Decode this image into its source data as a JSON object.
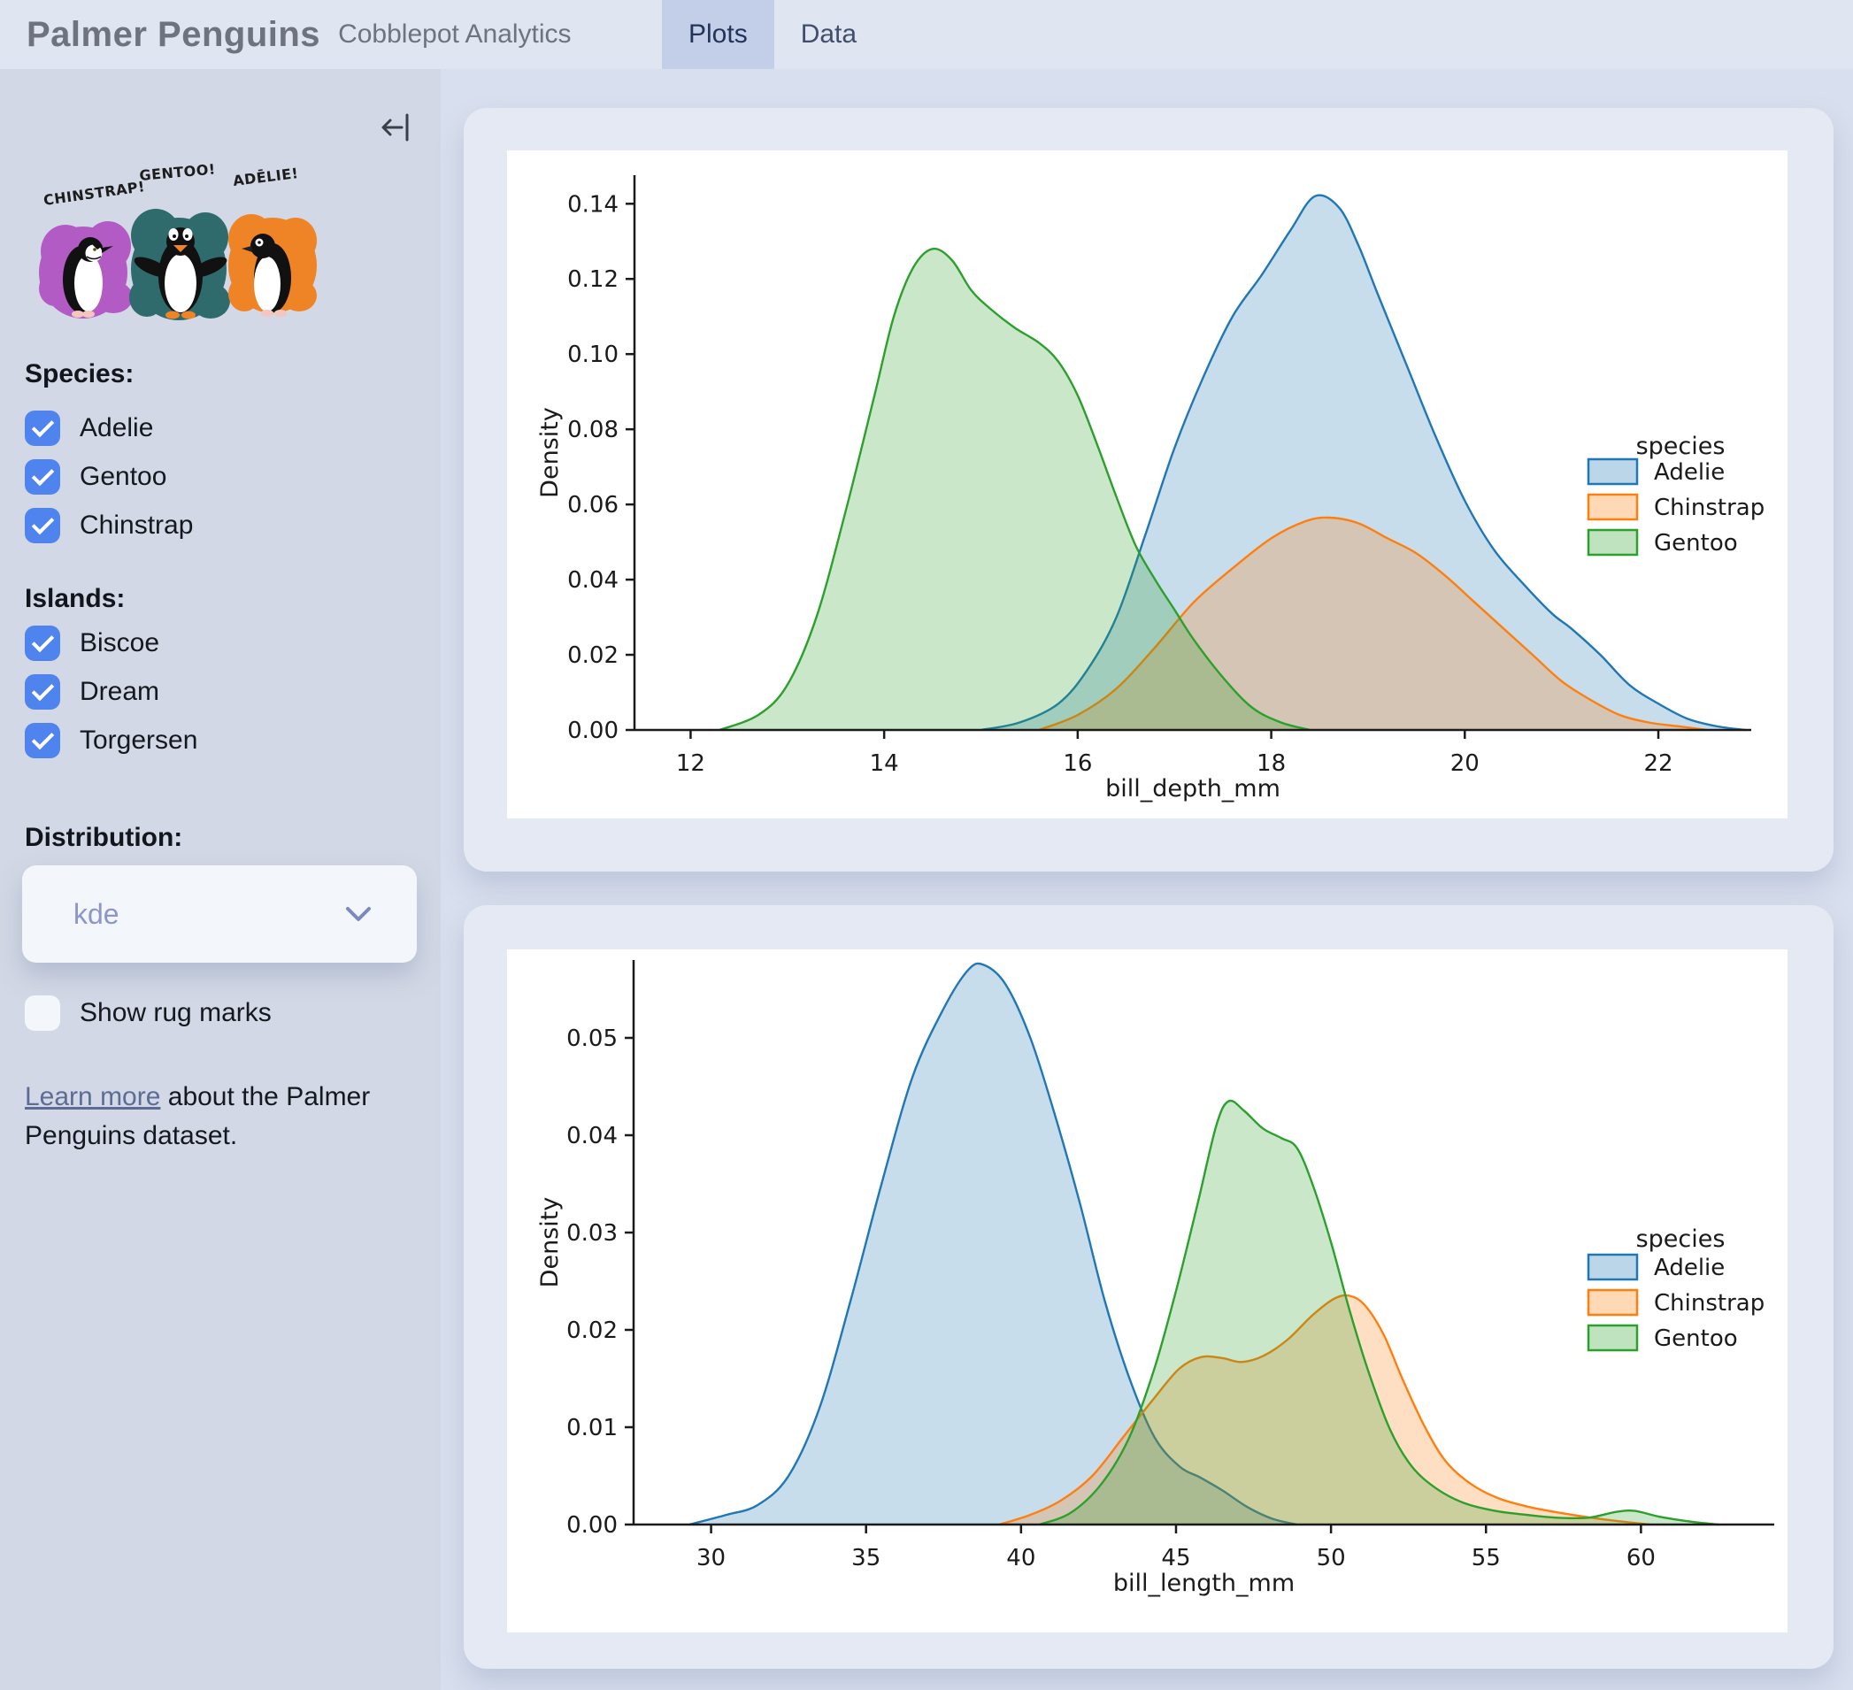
{
  "header": {
    "title": "Palmer Penguins",
    "subtitle": "Cobblepot Analytics",
    "tabs": [
      {
        "label": "Plots",
        "active": true
      },
      {
        "label": "Data",
        "active": false
      }
    ]
  },
  "sidebar": {
    "artwork_labels": {
      "chinstrap": "CHINSTRAP!",
      "gentoo": "GENTOO!",
      "adelie": "ADĒLIE!"
    },
    "species": {
      "heading": "Species:",
      "options": [
        {
          "label": "Adelie",
          "checked": true
        },
        {
          "label": "Gentoo",
          "checked": true
        },
        {
          "label": "Chinstrap",
          "checked": true
        }
      ]
    },
    "islands": {
      "heading": "Islands:",
      "options": [
        {
          "label": "Biscoe",
          "checked": true
        },
        {
          "label": "Dream",
          "checked": true
        },
        {
          "label": "Torgersen",
          "checked": true
        }
      ]
    },
    "distribution": {
      "heading": "Distribution:",
      "selected": "kde"
    },
    "rug": {
      "label": "Show rug marks",
      "checked": false
    },
    "footnote": {
      "link_text": "Learn more",
      "text_after": " about the Palmer Penguins dataset."
    }
  },
  "colors": {
    "adelie": "#1f77b4",
    "chinstrap": "#ff7f0e",
    "gentoo": "#2ca02c",
    "checkbox_blue": "#4f83ee",
    "tab_active_bg": "#c3cee8",
    "art_purple": "#b35bc4",
    "art_teal": "#2f6a6d",
    "art_orange": "#ef8426"
  },
  "chart_data": [
    {
      "type": "area",
      "kind": "kde",
      "xlabel": "bill_depth_mm",
      "ylabel": "Density",
      "xlim": [
        11.42,
        22.96
      ],
      "ylim": [
        0,
        0.1476
      ],
      "xticks": [
        12,
        14,
        16,
        18,
        20,
        22
      ],
      "yticks": [
        0.0,
        0.02,
        0.04,
        0.06,
        0.08,
        0.1,
        0.12,
        0.14
      ],
      "legend_title": "species",
      "legend_position": "center right",
      "grid": false,
      "series": [
        {
          "name": "Adelie",
          "color": "#1f77b4",
          "points": [
            [
              15.0,
              0
            ],
            [
              15.4,
              0.002
            ],
            [
              15.8,
              0.007
            ],
            [
              16.1,
              0.016
            ],
            [
              16.4,
              0.03
            ],
            [
              16.7,
              0.052
            ],
            [
              17.0,
              0.075
            ],
            [
              17.3,
              0.094
            ],
            [
              17.6,
              0.11
            ],
            [
              17.9,
              0.121
            ],
            [
              18.2,
              0.133
            ],
            [
              18.45,
              0.142
            ],
            [
              18.7,
              0.139
            ],
            [
              18.9,
              0.129
            ],
            [
              19.1,
              0.116
            ],
            [
              19.4,
              0.097
            ],
            [
              19.7,
              0.078
            ],
            [
              20.0,
              0.061
            ],
            [
              20.3,
              0.048
            ],
            [
              20.6,
              0.039
            ],
            [
              20.9,
              0.031
            ],
            [
              21.1,
              0.027
            ],
            [
              21.4,
              0.02
            ],
            [
              21.7,
              0.012
            ],
            [
              22.0,
              0.007
            ],
            [
              22.3,
              0.003
            ],
            [
              22.6,
              0.001
            ],
            [
              22.9,
              0
            ]
          ]
        },
        {
          "name": "Chinstrap",
          "color": "#ff7f0e",
          "points": [
            [
              15.6,
              0
            ],
            [
              16.0,
              0.004
            ],
            [
              16.4,
              0.011
            ],
            [
              16.8,
              0.022
            ],
            [
              17.2,
              0.034
            ],
            [
              17.6,
              0.043
            ],
            [
              18.0,
              0.051
            ],
            [
              18.35,
              0.0555
            ],
            [
              18.6,
              0.0565
            ],
            [
              18.9,
              0.055
            ],
            [
              19.2,
              0.051
            ],
            [
              19.5,
              0.047
            ],
            [
              19.8,
              0.041
            ],
            [
              20.1,
              0.034
            ],
            [
              20.4,
              0.027
            ],
            [
              20.7,
              0.02
            ],
            [
              21.0,
              0.013
            ],
            [
              21.3,
              0.008
            ],
            [
              21.6,
              0.004
            ],
            [
              21.9,
              0.002
            ],
            [
              22.2,
              0.001
            ],
            [
              22.5,
              0
            ]
          ]
        },
        {
          "name": "Gentoo",
          "color": "#2ca02c",
          "points": [
            [
              12.3,
              0
            ],
            [
              12.7,
              0.004
            ],
            [
              13.0,
              0.012
            ],
            [
              13.3,
              0.03
            ],
            [
              13.6,
              0.058
            ],
            [
              13.9,
              0.089
            ],
            [
              14.1,
              0.11
            ],
            [
              14.3,
              0.123
            ],
            [
              14.5,
              0.128
            ],
            [
              14.7,
              0.125
            ],
            [
              14.9,
              0.117
            ],
            [
              15.1,
              0.112
            ],
            [
              15.35,
              0.107
            ],
            [
              15.6,
              0.103
            ],
            [
              15.8,
              0.098
            ],
            [
              16.0,
              0.089
            ],
            [
              16.2,
              0.076
            ],
            [
              16.4,
              0.062
            ],
            [
              16.6,
              0.049
            ],
            [
              16.8,
              0.04
            ],
            [
              17.0,
              0.032
            ],
            [
              17.2,
              0.024
            ],
            [
              17.5,
              0.014
            ],
            [
              17.8,
              0.006
            ],
            [
              18.1,
              0.002
            ],
            [
              18.4,
              0
            ]
          ]
        }
      ]
    },
    {
      "type": "area",
      "kind": "kde",
      "xlabel": "bill_length_mm",
      "ylabel": "Density",
      "xlim": [
        27.5,
        64.3
      ],
      "ylim": [
        0,
        0.058
      ],
      "xticks": [
        30,
        35,
        40,
        45,
        50,
        55,
        60
      ],
      "yticks": [
        0.0,
        0.01,
        0.02,
        0.03,
        0.04,
        0.05
      ],
      "legend_title": "species",
      "legend_position": "center right",
      "grid": false,
      "series": [
        {
          "name": "Adelie",
          "color": "#1f77b4",
          "points": [
            [
              29.3,
              0
            ],
            [
              30.5,
              0.001
            ],
            [
              31.5,
              0.002
            ],
            [
              32.5,
              0.005
            ],
            [
              33.5,
              0.012
            ],
            [
              34.5,
              0.023
            ],
            [
              35.5,
              0.035
            ],
            [
              36.5,
              0.046
            ],
            [
              37.5,
              0.053
            ],
            [
              38.3,
              0.057
            ],
            [
              38.8,
              0.0575
            ],
            [
              39.5,
              0.0555
            ],
            [
              40.3,
              0.05
            ],
            [
              41.1,
              0.042
            ],
            [
              41.9,
              0.033
            ],
            [
              42.7,
              0.023
            ],
            [
              43.5,
              0.015
            ],
            [
              44.3,
              0.009
            ],
            [
              45.1,
              0.006
            ],
            [
              45.8,
              0.0048
            ],
            [
              46.5,
              0.0035
            ],
            [
              47.3,
              0.0018
            ],
            [
              48.1,
              0.0006
            ],
            [
              48.9,
              0
            ]
          ]
        },
        {
          "name": "Chinstrap",
          "color": "#ff7f0e",
          "points": [
            [
              39.3,
              0
            ],
            [
              40.3,
              0.001
            ],
            [
              41.3,
              0.0025
            ],
            [
              42.3,
              0.005
            ],
            [
              43.3,
              0.009
            ],
            [
              44.3,
              0.013
            ],
            [
              45.1,
              0.016
            ],
            [
              45.8,
              0.0172
            ],
            [
              46.5,
              0.0171
            ],
            [
              47.1,
              0.0167
            ],
            [
              47.8,
              0.0173
            ],
            [
              48.6,
              0.019
            ],
            [
              49.4,
              0.0215
            ],
            [
              50.1,
              0.0232
            ],
            [
              50.6,
              0.0235
            ],
            [
              51.1,
              0.0225
            ],
            [
              51.7,
              0.0195
            ],
            [
              52.3,
              0.015
            ],
            [
              53.0,
              0.0102
            ],
            [
              53.7,
              0.0065
            ],
            [
              54.5,
              0.0042
            ],
            [
              55.4,
              0.0027
            ],
            [
              56.4,
              0.0018
            ],
            [
              57.4,
              0.0012
            ],
            [
              58.4,
              0.0007
            ],
            [
              59.4,
              0.0003
            ],
            [
              60.3,
              0
            ]
          ]
        },
        {
          "name": "Gentoo",
          "color": "#2ca02c",
          "points": [
            [
              40.6,
              0
            ],
            [
              41.6,
              0.0012
            ],
            [
              42.6,
              0.0042
            ],
            [
              43.5,
              0.009
            ],
            [
              44.3,
              0.016
            ],
            [
              45.0,
              0.024
            ],
            [
              45.7,
              0.033
            ],
            [
              46.3,
              0.041
            ],
            [
              46.7,
              0.0435
            ],
            [
              47.2,
              0.0425
            ],
            [
              47.8,
              0.0407
            ],
            [
              48.4,
              0.0397
            ],
            [
              48.9,
              0.0387
            ],
            [
              49.4,
              0.035
            ],
            [
              50.0,
              0.029
            ],
            [
              50.6,
              0.022
            ],
            [
              51.2,
              0.0158
            ],
            [
              51.9,
              0.0098
            ],
            [
              52.6,
              0.006
            ],
            [
              53.4,
              0.0037
            ],
            [
              54.3,
              0.0022
            ],
            [
              55.3,
              0.0014
            ],
            [
              56.3,
              0.001
            ],
            [
              57.3,
              0.0007
            ],
            [
              58.3,
              0.0007
            ],
            [
              59.2,
              0.0013
            ],
            [
              59.8,
              0.0014
            ],
            [
              60.6,
              0.0008
            ],
            [
              61.6,
              0.0003
            ],
            [
              62.5,
              0
            ]
          ]
        }
      ]
    }
  ]
}
